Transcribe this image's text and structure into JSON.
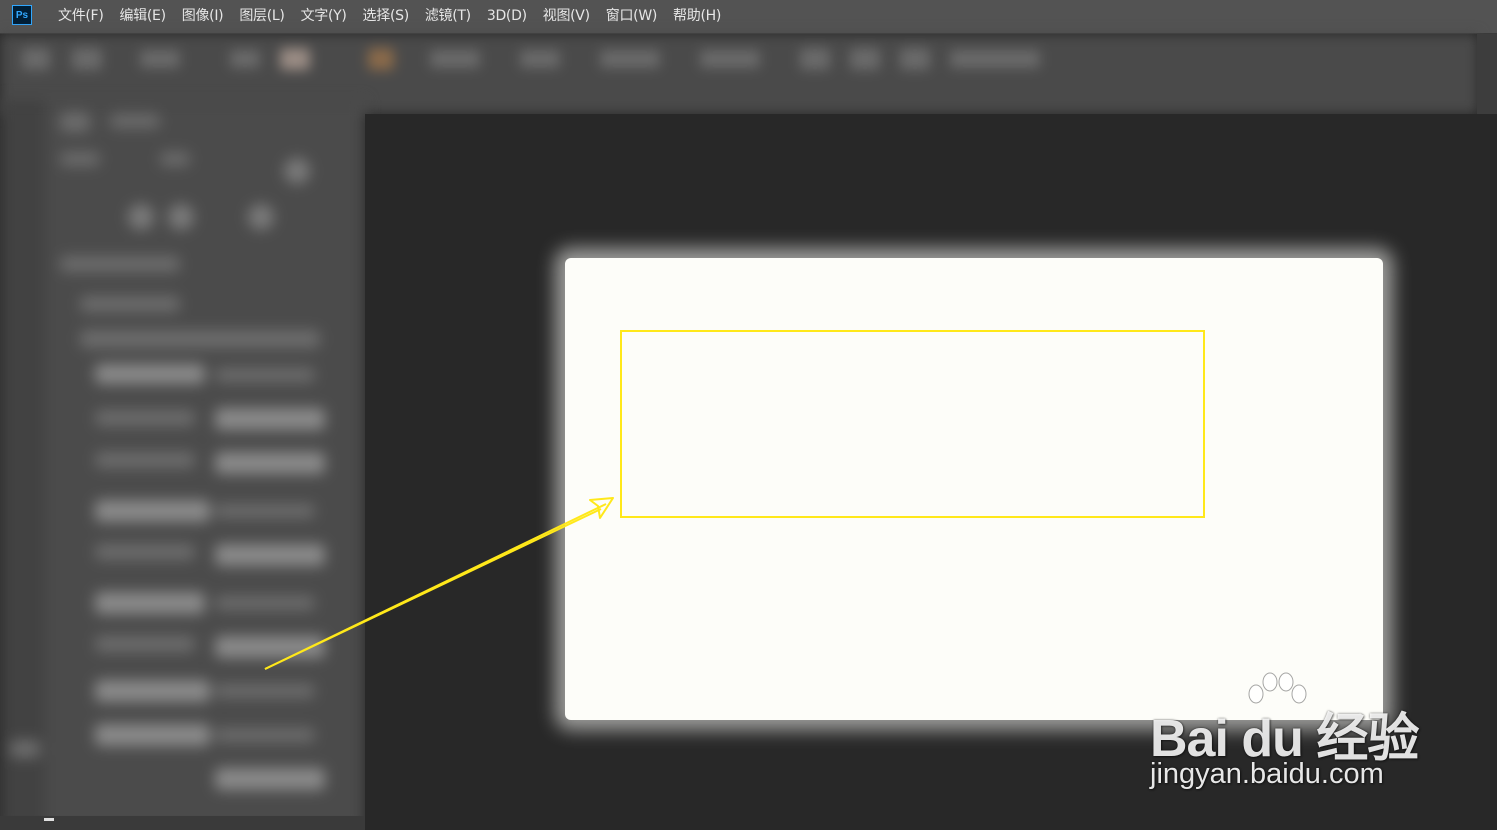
{
  "app": {
    "logo_text": "Ps",
    "accent_color": "#31a8ff"
  },
  "menubar": {
    "items": [
      {
        "label": "文件(F)"
      },
      {
        "label": "编辑(E)"
      },
      {
        "label": "图像(I)"
      },
      {
        "label": "图层(L)"
      },
      {
        "label": "文字(Y)"
      },
      {
        "label": "选择(S)"
      },
      {
        "label": "滤镜(T)"
      },
      {
        "label": "3D(D)"
      },
      {
        "label": "视图(V)"
      },
      {
        "label": "窗口(W)"
      },
      {
        "label": "帮助(H)"
      }
    ]
  },
  "annotation": {
    "color": "#ffe81a",
    "shapes": [
      "highlight-rectangle",
      "pointer-arrow"
    ]
  },
  "document": {
    "background_color": "#fdfdf9"
  },
  "watermark": {
    "brand": "Bai du 经验",
    "url": "jingyan.baidu.com"
  }
}
